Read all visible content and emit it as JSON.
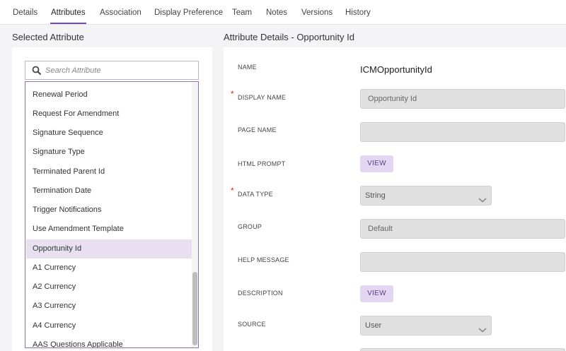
{
  "tabs": [
    {
      "label": "Details",
      "active": false
    },
    {
      "label": "Attributes",
      "active": true
    },
    {
      "label": "Association",
      "active": false
    },
    {
      "label": "Display Preference",
      "active": false
    },
    {
      "label": "Team",
      "active": false
    },
    {
      "label": "Notes",
      "active": false
    },
    {
      "label": "Versions",
      "active": false
    },
    {
      "label": "History",
      "active": false
    }
  ],
  "left": {
    "title": "Selected Attribute",
    "search_placeholder": "Search Attribute",
    "items": [
      "Renewal Period",
      "Request For Amendment",
      "Signature Sequence",
      "Signature Type",
      "Terminated Parent Id",
      "Termination Date",
      "Trigger Notifications",
      "Use Amendment Template",
      "Opportunity Id",
      "A1 Currency",
      "A2 Currency",
      "A3 Currency",
      "A4 Currency",
      "AAS Questions Applicable"
    ],
    "selected": "Opportunity Id"
  },
  "right": {
    "title": "Attribute Details - Opportunity Id",
    "fields": {
      "name": {
        "label": "NAME",
        "value": "ICMOpportunityId"
      },
      "display_name": {
        "label": "DISPLAY NAME",
        "value": "Opportunity Id",
        "required": true
      },
      "page_name": {
        "label": "PAGE NAME",
        "value": ""
      },
      "html_prompt": {
        "label": "HTML PROMPT",
        "button": "VIEW"
      },
      "data_type": {
        "label": "DATA TYPE",
        "value": "String",
        "required": true
      },
      "group": {
        "label": "GROUP",
        "value": "Default"
      },
      "help_message": {
        "label": "HELP MESSAGE",
        "value": ""
      },
      "description": {
        "label": "DESCRIPTION",
        "button": "VIEW"
      },
      "source": {
        "label": "SOURCE",
        "value": "User"
      }
    }
  },
  "colors": {
    "accent": "#6c4fa0",
    "selected_row": "#e8e0f0",
    "view_button_bg": "#e2d6f0",
    "required": "#d32f2f"
  }
}
